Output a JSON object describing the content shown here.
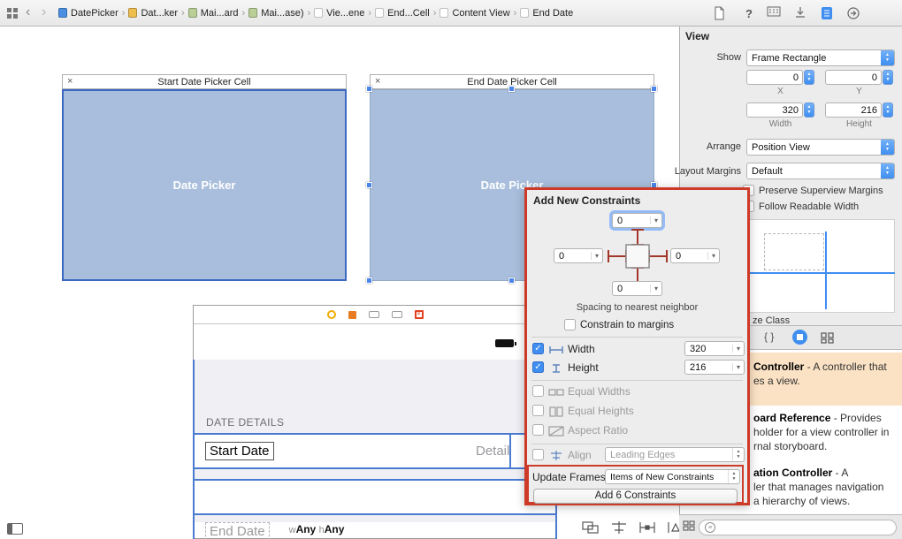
{
  "colors": {
    "annotation": "#ce3a28",
    "picker_blue": "#a8bedc",
    "selection_blue": "#4a7bd0",
    "accent_blue": "#3f8ef0",
    "library_highlight": "#fbe2c4"
  },
  "glyphs": {
    "back": "‹",
    "forward": "›",
    "separator": "›",
    "help": "?",
    "close": "×",
    "combo_arrow": "▾",
    "up": "▲",
    "down": "▼",
    "check": "✓",
    "braces": "{ }",
    "filter": "≡"
  },
  "jumpbar": {
    "items": [
      {
        "label": "DatePicker"
      },
      {
        "label": "Dat...ker"
      },
      {
        "label": "Mai...ard"
      },
      {
        "label": "Mai...ase)"
      },
      {
        "label": "Vie...ene"
      },
      {
        "label": "End...Cell"
      },
      {
        "label": "Content View"
      },
      {
        "label": "End Date"
      }
    ]
  },
  "canvas": {
    "start_cell": {
      "title": "Start Date Picker Cell",
      "body_label": "Date Picker"
    },
    "end_cell": {
      "title": "End Date Picker Cell",
      "body_label": "Date Picker"
    },
    "table": {
      "section_header": "DATE DETAILS",
      "row1_title": "Start Date",
      "row1_detail": "Detail",
      "row2_title": "End Date"
    },
    "size_class": {
      "w_key": "w",
      "w_value": "Any",
      "h_key": "h",
      "h_value": "Any"
    }
  },
  "inspector": {
    "title": "View",
    "show_label": "Show",
    "show_value": "Frame Rectangle",
    "x_value": "0",
    "x_label": "X",
    "y_value": "0",
    "y_label": "Y",
    "width_value": "320",
    "width_label": "Width",
    "height_value": "216",
    "height_label": "Height",
    "arrange_label": "Arrange",
    "arrange_value": "Position View",
    "margins_label": "Layout Margins",
    "margins_value": "Default",
    "preserve_margins_label": "Preserve Superview Margins",
    "readable_width_label": "Follow Readable Width",
    "size_class_fragment": "ze Class"
  },
  "library": {
    "items": [
      {
        "title_fragment": "Controller",
        "line1_rest": " - A controller that",
        "line2": "es a view.",
        "line3": ""
      },
      {
        "title_fragment": "oard Reference",
        "line1_rest": " - Provides",
        "line2": "holder for a view controller in",
        "line3": "rnal storyboard."
      },
      {
        "title_fragment": "ation Controller",
        "line1_rest": " - A",
        "line2": "ler that manages navigation",
        "line3": "a hierarchy of views."
      }
    ]
  },
  "popover": {
    "title": "Add New Constraints",
    "top_value": "0",
    "left_value": "0",
    "right_value": "0",
    "bottom_value": "0",
    "spacing_caption": "Spacing to nearest neighbor",
    "constrain_margins_label": "Constrain to margins",
    "width_label": "Width",
    "width_value": "320",
    "height_label": "Height",
    "height_value": "216",
    "equal_widths_label": "Equal Widths",
    "equal_heights_label": "Equal Heights",
    "aspect_ratio_label": "Aspect Ratio",
    "align_label": "Align",
    "align_value": "Leading Edges",
    "update_frames_label": "Update Frames",
    "update_frames_value": "Items of New Constraints",
    "add_button_label": "Add 6 Constraints"
  }
}
